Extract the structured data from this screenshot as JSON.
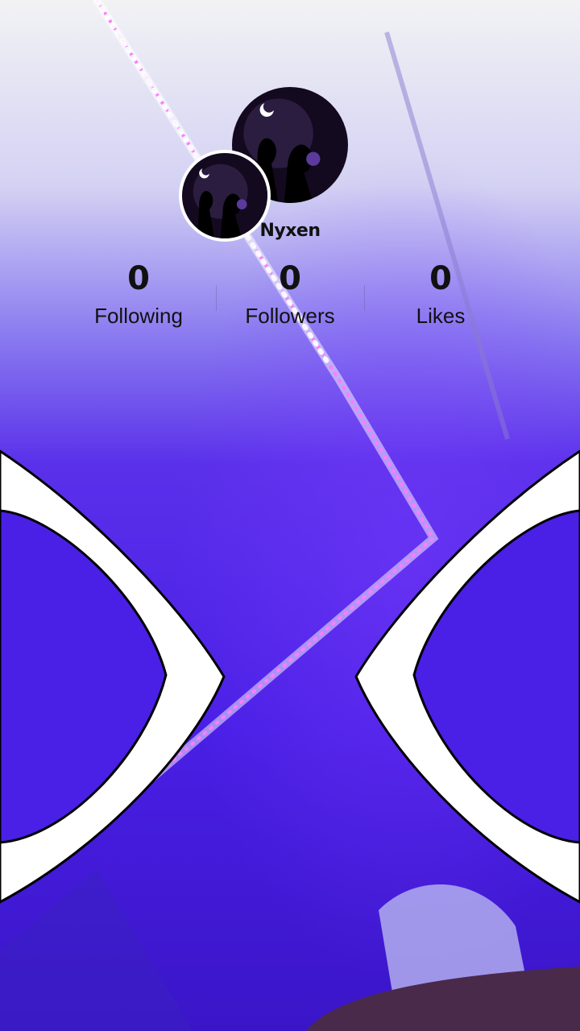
{
  "profile": {
    "username": "Nyxen"
  },
  "stats": [
    {
      "value": "0",
      "label": "Following"
    },
    {
      "value": "0",
      "label": "Followers"
    },
    {
      "value": "0",
      "label": "Likes"
    }
  ],
  "colors": {
    "sky_top": "#f2f2f5",
    "wall_purple": "#4a1fe6",
    "led_pink": "#ff55ff",
    "led_white": "#ffffff",
    "frame_white": "#ffffff"
  },
  "icons": {
    "avatar_main": "avatar-image",
    "avatar_small": "avatar-image"
  }
}
